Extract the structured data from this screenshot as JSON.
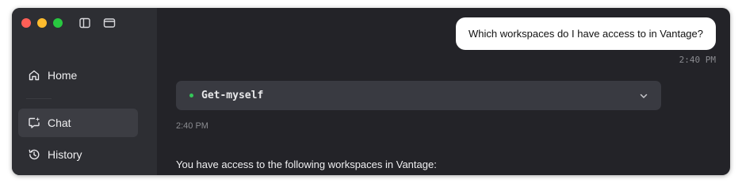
{
  "sidebar": {
    "items": [
      {
        "label": "Home",
        "icon": "home-icon",
        "active": false
      },
      {
        "label": "Chat",
        "icon": "chat-icon",
        "active": true
      },
      {
        "label": "History",
        "icon": "history-icon",
        "active": false
      }
    ]
  },
  "chat": {
    "user_message": "Which workspaces do I have access to in Vantage?",
    "user_timestamp": "2:40 PM",
    "tool_call": {
      "name": "Get-myself",
      "status_color": "#34c759"
    },
    "tool_timestamp": "2:40 PM",
    "assistant_message": "You have access to the following workspaces in Vantage:"
  },
  "colors": {
    "close": "#ff5f57",
    "minimize": "#febc2e",
    "zoom": "#28c840"
  }
}
